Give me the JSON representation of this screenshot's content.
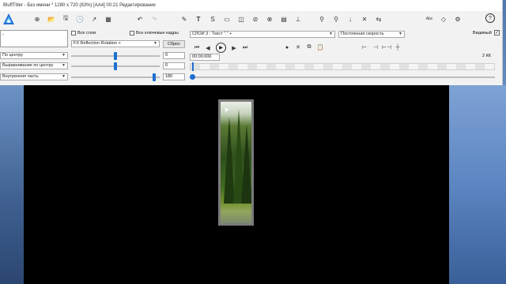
{
  "window": {
    "title": "BluffTitler - Без имени * 1280 x 720 (83%) [AA4] 00:21 Редактирование"
  },
  "toolbar": {
    "file_icons": [
      "new-icon",
      "open-icon",
      "save-icon",
      "recent-icon",
      "export-icon",
      "render-icon"
    ],
    "undo_icons": [
      "undo-icon",
      "redo-icon"
    ],
    "layer_icons": [
      "paint-icon",
      "text-icon",
      "s-icon",
      "image-icon",
      "camera-icon",
      "link-icon",
      "effect-icon",
      "plugin-icon",
      "layer-icon",
      "key-icon",
      "key-next-icon",
      "key-down-icon",
      "key-x-icon",
      "key-sync-icon"
    ],
    "right_icons": [
      "abc-icon",
      "shape-icon",
      "settings-icon",
      "help-icon"
    ],
    "help_label": "?"
  },
  "left_panel": {
    "text_box": "-",
    "align_h": "По центру",
    "align_v": "Выравнивание по центру",
    "inner": "Внутренняя часть"
  },
  "mid_panel": {
    "all_layers_label": "Все слои",
    "all_keyframes_label": "Все ключевые кадры",
    "effect_select": "FX Reflection Rotation +",
    "reset_label": "Сброс",
    "value1": "0",
    "value2": "0",
    "value3": "180"
  },
  "right_panel": {
    "layer_select": "СЛОЙ 3 : Текст \".\" +",
    "speed_select": "Постоянная скорость",
    "visible_label": "Видимый",
    "visible_checked": "✓",
    "time_value": "00:00.000",
    "kk_label": "2 КК"
  },
  "transport": {
    "icons": [
      "first-icon",
      "prev-icon",
      "play-icon",
      "next-icon",
      "last-icon"
    ]
  }
}
